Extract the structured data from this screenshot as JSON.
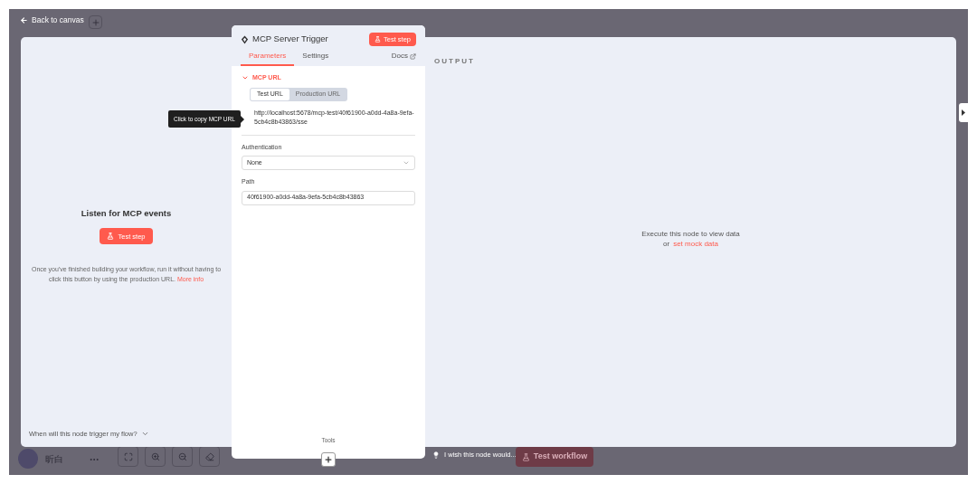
{
  "header": {
    "back_label": "Back to canvas"
  },
  "input_panel": {
    "title": "Listen for MCP events",
    "button": "Test step",
    "hint": "Once you've finished building your workflow, run it without having to click this button by using the production URL.",
    "hint_link": "More info",
    "footer": "When will this node trigger my flow?"
  },
  "node": {
    "title": "MCP Server Trigger",
    "test_button": "Test step",
    "tabs": [
      {
        "label": "Parameters",
        "selected": true
      },
      {
        "label": "Settings",
        "selected": false
      }
    ],
    "docs": "Docs",
    "section": {
      "label": "MCP URL",
      "expanded": true
    },
    "url_tabs": [
      {
        "label": "Test URL",
        "selected": true
      },
      {
        "label": "Production URL",
        "selected": false
      }
    ],
    "url": "http://localhost:5678/mcp-test/40f61900-a0dd-4a8a-9efa-5cb4c8b43863/sse",
    "tooltip": "Click to copy MCP URL",
    "fields": [
      {
        "label": "Authentication",
        "kind": "select",
        "value": "None"
      },
      {
        "label": "Path",
        "kind": "text",
        "value": "40f61900-a0dd-4a8a-9efa-5cb4c8b43863"
      }
    ],
    "footer": "Tools"
  },
  "output_panel": {
    "title": "OUTPUT",
    "empty_text": "Execute this node to view data",
    "empty_prefix": "or",
    "mock_link": "set mock data"
  },
  "canvas": {
    "user": "昕白",
    "feedback": "I wish this node would...",
    "test_workflow": "Test workflow"
  }
}
